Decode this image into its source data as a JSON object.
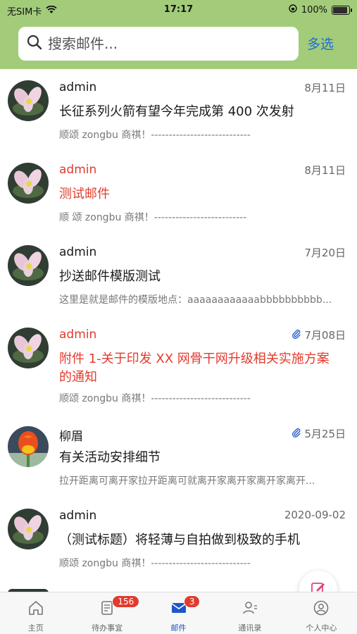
{
  "status_bar": {
    "carrier": "无SIM卡",
    "time": "17:17",
    "battery": "100%",
    "battery_level": 1.0
  },
  "search": {
    "placeholder": "搜索邮件..."
  },
  "header": {
    "multi_select": "多选"
  },
  "emails": [
    {
      "sender": "admin",
      "date": "8月11日",
      "subject": "长征系列火箭有望今年完成第 400 次发射",
      "preview": "顺颂 zongbu 商祺！----------------------------",
      "unread": false,
      "attachment": false,
      "avatar": "lotus-flower"
    },
    {
      "sender": "admin",
      "date": "8月11日",
      "subject": "测试邮件",
      "preview": "顺 颂 zongbu 商祺！--------------------------",
      "unread": true,
      "attachment": false,
      "avatar": "lotus-flower"
    },
    {
      "sender": "admin",
      "date": "7月20日",
      "subject": "抄送邮件模版测试",
      "preview": "这里是就是邮件的模版地点：aaaaaaaaaaaabbbbbbbbbb...",
      "unread": false,
      "attachment": false,
      "avatar": "lotus-flower"
    },
    {
      "sender": "admin",
      "date": "7月08日",
      "subject": "附件 1-关于印发 XX 网骨干网升级相关实施方案的通知",
      "preview": "顺颂 zongbu 商祺！----------------------------",
      "unread": true,
      "attachment": true,
      "avatar": "lotus-flower"
    },
    {
      "sender": "柳眉",
      "date": "5月25日",
      "subject": "有关活动安排细节",
      "preview": "拉开距离可离开家拉开距离可就离开家离开家离开家离开...",
      "unread": false,
      "attachment": true,
      "avatar": "tulip"
    },
    {
      "sender": "admin",
      "date": "2020-09-02",
      "subject": "（测试标题）将轻薄与自拍做到极致的手机",
      "preview": "顺颂 zongbu 商祺！----------------------------",
      "unread": false,
      "attachment": false,
      "avatar": "lotus-flower"
    }
  ],
  "tabbar": {
    "tabs": [
      {
        "label": "主页",
        "icon": "home-icon",
        "badge": ""
      },
      {
        "label": "待办事宜",
        "icon": "todo-icon",
        "badge": "156"
      },
      {
        "label": "邮件",
        "icon": "mail-icon",
        "badge": "3"
      },
      {
        "label": "通讯录",
        "icon": "contacts-icon",
        "badge": ""
      },
      {
        "label": "个人中心",
        "icon": "profile-icon",
        "badge": ""
      }
    ]
  },
  "colors": {
    "header_green": "#a3cc7a",
    "unread_red": "#e23b2e",
    "accent_blue": "#1e55c8",
    "badge_red": "#e23b2e"
  }
}
